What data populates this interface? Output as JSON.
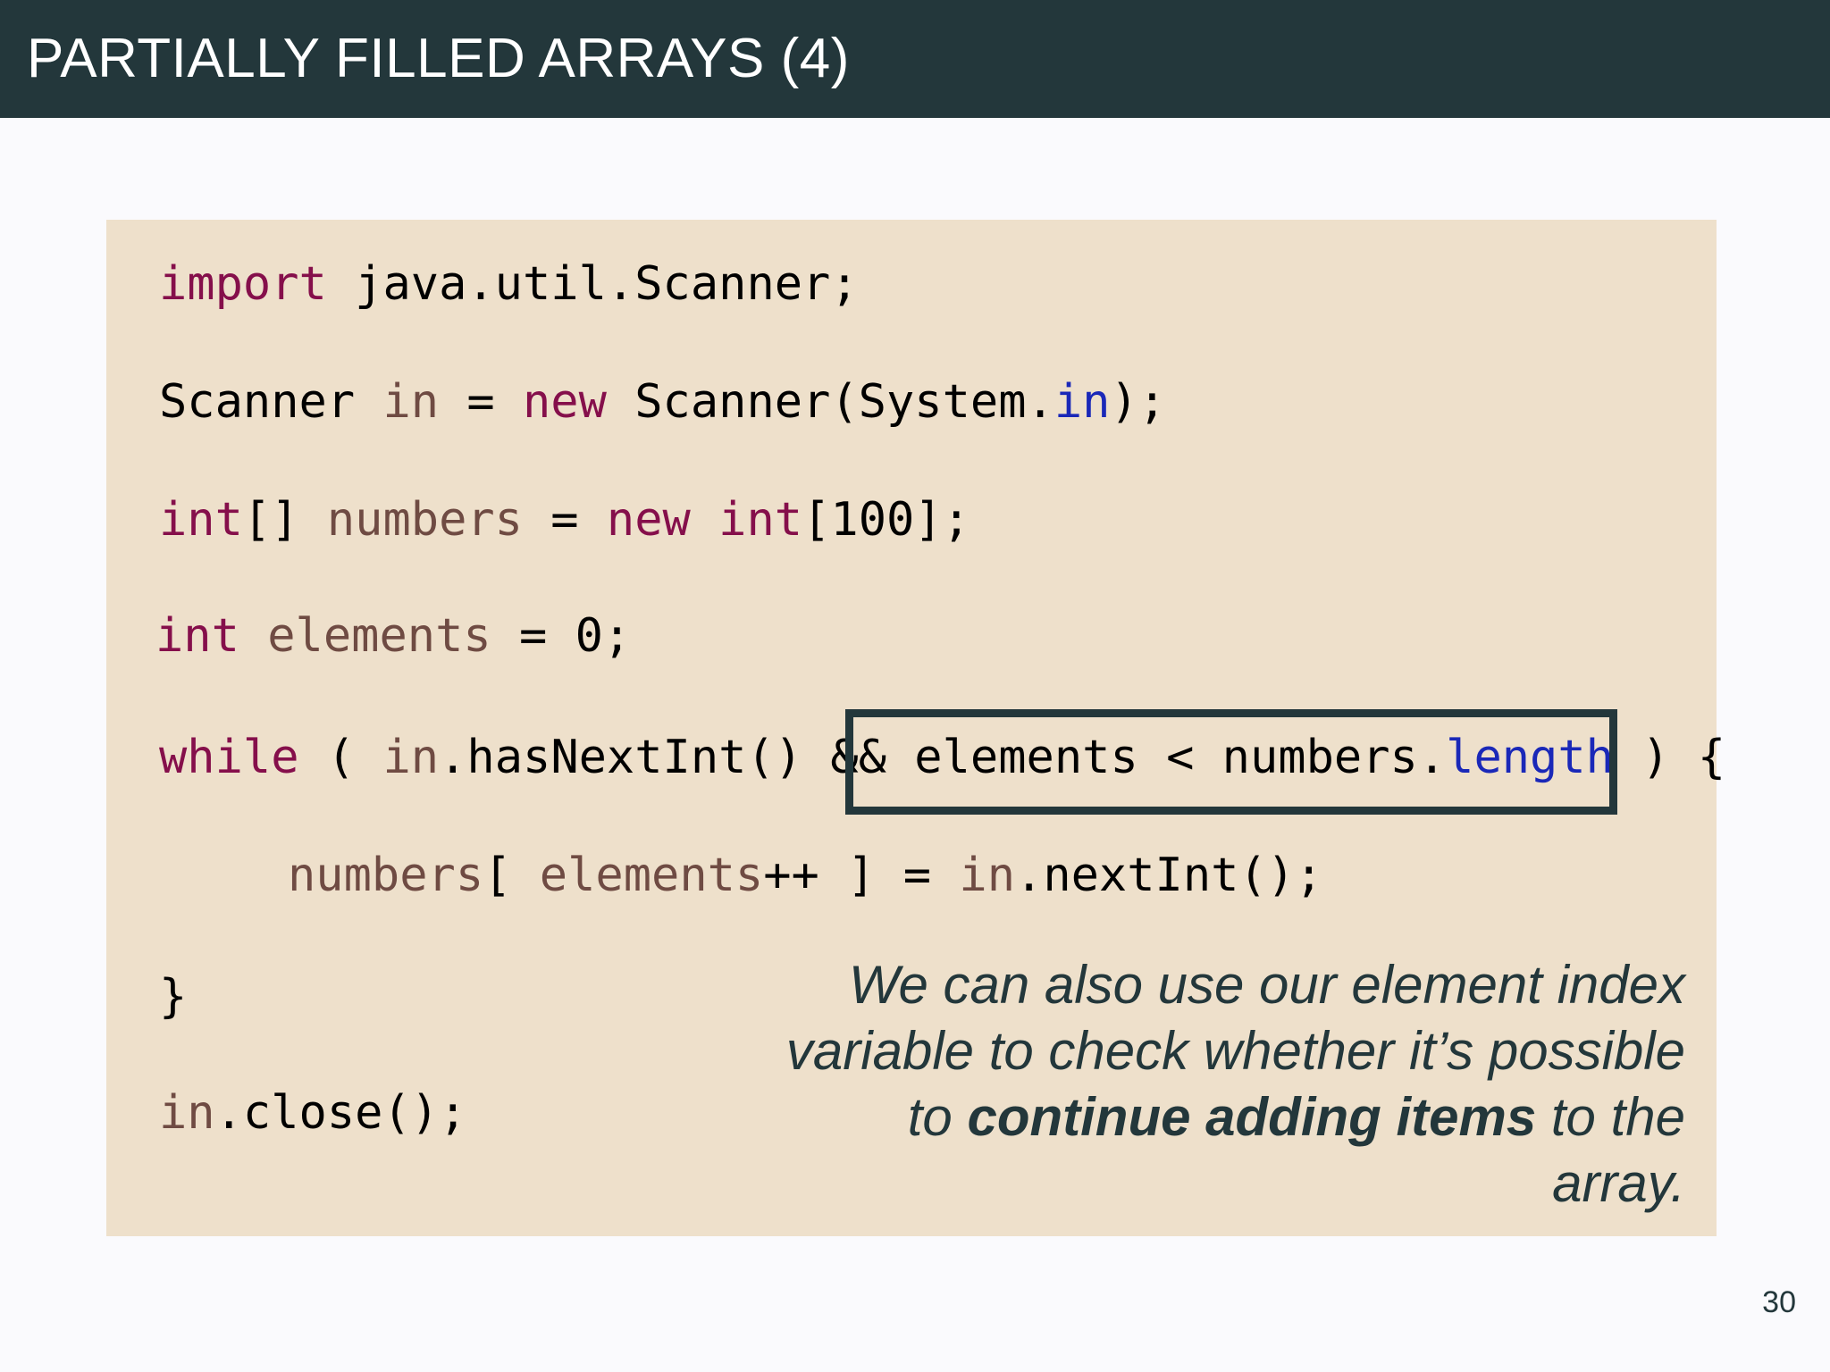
{
  "slide": {
    "title": "PARTIALLY FILLED ARRAYS (4)",
    "page_number": "30"
  },
  "code": {
    "l1": {
      "kw": "import",
      "rest": " java.util.Scanner;"
    },
    "l2": {
      "type": "Scanner ",
      "var": "in",
      "eq": " = ",
      "kw": "new",
      "call": " Scanner(System.",
      "fld": "in",
      "end": ");"
    },
    "l3": {
      "kw1": "int",
      "br": "[] ",
      "var": "numbers",
      "eq": " = ",
      "kw2": "new",
      "sp": " ",
      "kw3": "int",
      "end": "[100];"
    },
    "l4": {
      "kw": "int",
      "sp": " ",
      "var": "elements",
      "end": " = 0;"
    },
    "l5": {
      "kw": "while",
      "p1": " ( ",
      "var": "in",
      "call": ".hasNextInt() && elements < numbers.",
      "fld": "length",
      "end": " ) {"
    },
    "l6": {
      "var1": "numbers",
      "br": "[ ",
      "var2": "elements",
      "op": "++ ] = ",
      "var3": "in",
      "end": ".nextInt();"
    },
    "l7": {
      "text": "}"
    },
    "l8": {
      "var": "in",
      "end": ".close();"
    }
  },
  "note": {
    "part1": "We can also use our element index variable to check whether it’s possible to ",
    "bold": "continue adding items",
    "part2": " to the array."
  },
  "colors": {
    "title_bar": "#23373b",
    "code_background": "#eee0cb",
    "keyword": "#850f4b",
    "variable": "#6f4b43",
    "field": "#1a28b8"
  }
}
